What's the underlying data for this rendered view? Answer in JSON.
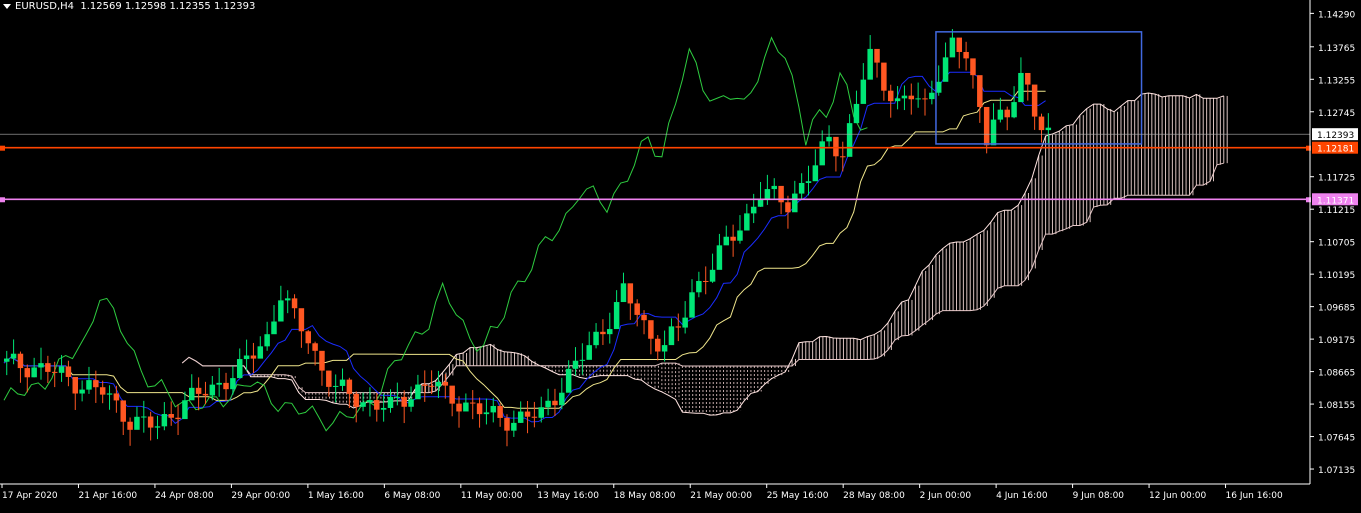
{
  "header": {
    "symbol_tf": "EURUSD,H4",
    "ohlc": "1.12569 1.12598 1.12355 1.12393"
  },
  "colors": {
    "background": "#000000",
    "bull": "#00e676",
    "bear": "#ff5722",
    "tenkan": "#1a2cff",
    "kijun": "#f0e68c",
    "chikou": "#2ecc40",
    "cloud_a": "#ffe4e1",
    "cloud_b": "#e6c8c8",
    "grid_text": "#ffffff",
    "hline_red": "#ff4500",
    "hline_violet": "#ee82ee",
    "rect": "#4169e1",
    "bid_line": "#b0b0b0"
  },
  "chart_data": {
    "type": "candlestick",
    "title": "EURUSD,H4",
    "ylim": [
      1.069,
      1.145
    ],
    "y_ticks": [
      "1.14290",
      "1.13765",
      "1.13255",
      "1.12745",
      "1.11725",
      "1.11215",
      "1.10705",
      "1.10195",
      "1.09685",
      "1.09175",
      "1.08665",
      "1.08155",
      "1.07645",
      "1.07135"
    ],
    "x_labels": [
      "17 Apr 2020",
      "21 Apr 16:00",
      "24 Apr 08:00",
      "29 Apr 00:00",
      "1 May 16:00",
      "6 May 08:00",
      "11 May 00:00",
      "13 May 16:00",
      "18 May 08:00",
      "21 May 00:00",
      "25 May 16:00",
      "28 May 08:00",
      "2 Jun 00:00",
      "4 Jun 16:00",
      "9 Jun 08:00",
      "12 Jun 00:00",
      "16 Jun 16:00"
    ],
    "price_labels": [
      {
        "name": "bid",
        "value": 1.12393,
        "text": "1.12393"
      },
      {
        "name": "red-level",
        "value": 1.12181,
        "text": "1.12181"
      },
      {
        "name": "violet-level",
        "value": 1.11371,
        "text": "1.11371"
      }
    ],
    "close_path": [
      [
        0,
        1.088
      ],
      [
        6,
        1.087
      ],
      [
        10,
        1.085
      ],
      [
        14,
        1.0835
      ],
      [
        18,
        1.079
      ],
      [
        22,
        1.078
      ],
      [
        26,
        1.082
      ],
      [
        30,
        1.084
      ],
      [
        34,
        1.087
      ],
      [
        38,
        1.092
      ],
      [
        40,
        1.099
      ],
      [
        42,
        1.095
      ],
      [
        44,
        1.092
      ],
      [
        46,
        1.087
      ],
      [
        48,
        1.084
      ],
      [
        52,
        1.082
      ],
      [
        56,
        1.081
      ],
      [
        60,
        1.084
      ],
      [
        62,
        1.085
      ],
      [
        64,
        1.083
      ],
      [
        66,
        1.082
      ],
      [
        70,
        1.08
      ],
      [
        74,
        1.079
      ],
      [
        78,
        1.08
      ],
      [
        80,
        1.083
      ],
      [
        84,
        1.089
      ],
      [
        86,
        1.092
      ],
      [
        88,
        1.095
      ],
      [
        90,
        1.099
      ],
      [
        92,
        1.096
      ],
      [
        94,
        1.092
      ],
      [
        96,
        1.091
      ],
      [
        98,
        1.093
      ],
      [
        100,
        1.099
      ],
      [
        102,
        1.102
      ],
      [
        104,
        1.105
      ],
      [
        106,
        1.108
      ],
      [
        108,
        1.111
      ],
      [
        110,
        1.115
      ],
      [
        112,
        1.114
      ],
      [
        114,
        1.113
      ],
      [
        116,
        1.116
      ],
      [
        118,
        1.119
      ],
      [
        120,
        1.123
      ],
      [
        122,
        1.121
      ],
      [
        124,
        1.129
      ],
      [
        125,
        1.133
      ],
      [
        126,
        1.136
      ],
      [
        128,
        1.132
      ],
      [
        130,
        1.129
      ],
      [
        132,
        1.13
      ],
      [
        134,
        1.128
      ],
      [
        136,
        1.134
      ],
      [
        138,
        1.138
      ],
      [
        140,
        1.136
      ],
      [
        141,
        1.132
      ],
      [
        142,
        1.128
      ],
      [
        143,
        1.124
      ],
      [
        144,
        1.127
      ],
      [
        146,
        1.126
      ],
      [
        148,
        1.133
      ],
      [
        149,
        1.131
      ],
      [
        150,
        1.128
      ],
      [
        151,
        1.126
      ],
      [
        152,
        1.124
      ]
    ]
  }
}
